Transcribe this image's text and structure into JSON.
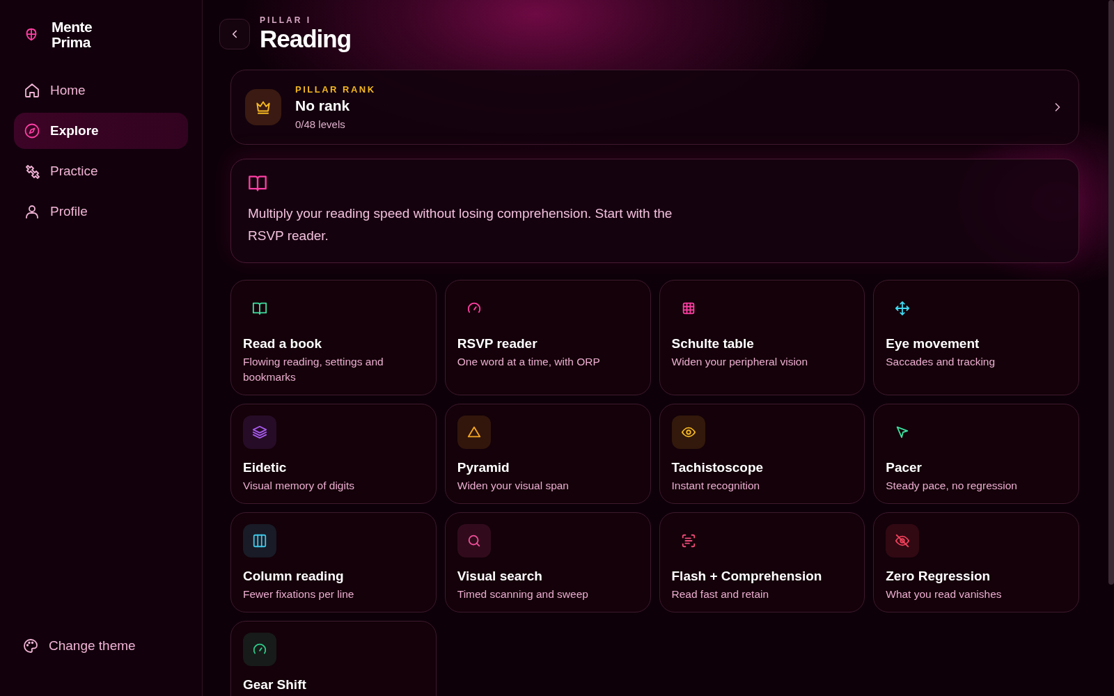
{
  "brand": {
    "name": "Mente Prima"
  },
  "nav": [
    {
      "kind": "home",
      "label": "Home",
      "selected": false
    },
    {
      "kind": "compass",
      "label": "Explore",
      "selected": true
    },
    {
      "kind": "dumbbell",
      "label": "Practice",
      "selected": false
    },
    {
      "kind": "user",
      "label": "Profile",
      "selected": false
    }
  ],
  "theme_button": {
    "label": "Change theme"
  },
  "header": {
    "eyebrow": "PILLAR I",
    "title": "Reading"
  },
  "rank_card": {
    "eyebrow": "PILLAR RANK",
    "title": "No rank",
    "subtitle": "0/48 levels"
  },
  "intro": {
    "text": "Multiply your reading speed without losing comprehension. Start with the RSVP reader."
  },
  "exercises": [
    {
      "kind": "book",
      "color": "#3ee0a0",
      "tile": false,
      "title": "Read a book",
      "subtitle": "Flowing reading, settings and bookmarks"
    },
    {
      "kind": "gauge",
      "color": "#ff3fa4",
      "tile": false,
      "title": "RSVP reader",
      "subtitle": "One word at a time, with ORP"
    },
    {
      "kind": "grid",
      "color": "#ff3fa4",
      "tile": false,
      "title": "Schulte table",
      "subtitle": "Widen your peripheral vision"
    },
    {
      "kind": "move",
      "color": "#3fd8f0",
      "tile": false,
      "title": "Eye movement",
      "subtitle": "Saccades and tracking"
    },
    {
      "kind": "layers",
      "color": "#a85cf0",
      "tile": true,
      "title": "Eidetic",
      "subtitle": "Visual memory of digits"
    },
    {
      "kind": "triangle",
      "color": "#f5a623",
      "tile": true,
      "title": "Pyramid",
      "subtitle": "Widen your visual span"
    },
    {
      "kind": "eye",
      "color": "#f5b821",
      "tile": true,
      "title": "Tachistoscope",
      "subtitle": "Instant recognition"
    },
    {
      "kind": "cursor",
      "color": "#3ee0a0",
      "tile": false,
      "title": "Pacer",
      "subtitle": "Steady pace, no regression"
    },
    {
      "kind": "columns",
      "color": "#3fc8e8",
      "tile": true,
      "title": "Column reading",
      "subtitle": "Fewer fixations per line"
    },
    {
      "kind": "search",
      "color": "#f0509a",
      "tile": true,
      "title": "Visual search",
      "subtitle": "Timed scanning and sweep"
    },
    {
      "kind": "scan",
      "color": "#f04a7a",
      "tile": false,
      "title": "Flash + Comprehension",
      "subtitle": "Read fast and retain"
    },
    {
      "kind": "eyeoff",
      "color": "#f0405a",
      "tile": true,
      "title": "Zero Regression",
      "subtitle": "What you read vanishes"
    },
    {
      "kind": "gauge",
      "color": "#2ec98a",
      "tile": true,
      "title": "Gear Shift"
    }
  ]
}
